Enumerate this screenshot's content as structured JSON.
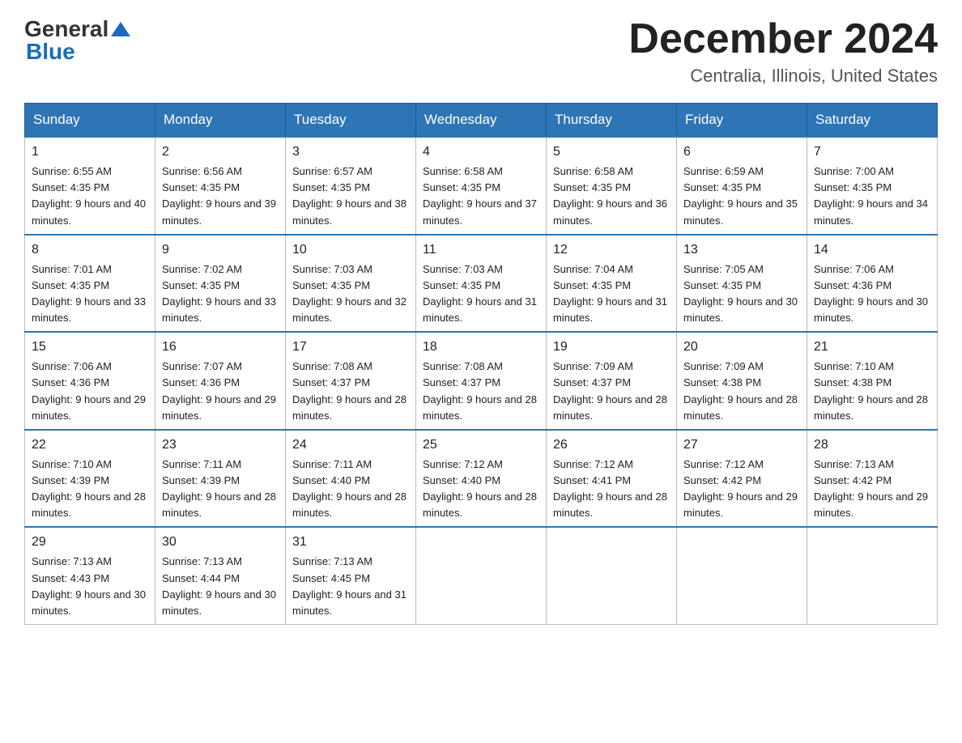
{
  "logo": {
    "general": "General",
    "blue": "Blue"
  },
  "header": {
    "month_year": "December 2024",
    "location": "Centralia, Illinois, United States"
  },
  "days_of_week": [
    "Sunday",
    "Monday",
    "Tuesday",
    "Wednesday",
    "Thursday",
    "Friday",
    "Saturday"
  ],
  "weeks": [
    [
      {
        "day": "1",
        "sunrise": "6:55 AM",
        "sunset": "4:35 PM",
        "daylight": "9 hours and 40 minutes."
      },
      {
        "day": "2",
        "sunrise": "6:56 AM",
        "sunset": "4:35 PM",
        "daylight": "9 hours and 39 minutes."
      },
      {
        "day": "3",
        "sunrise": "6:57 AM",
        "sunset": "4:35 PM",
        "daylight": "9 hours and 38 minutes."
      },
      {
        "day": "4",
        "sunrise": "6:58 AM",
        "sunset": "4:35 PM",
        "daylight": "9 hours and 37 minutes."
      },
      {
        "day": "5",
        "sunrise": "6:58 AM",
        "sunset": "4:35 PM",
        "daylight": "9 hours and 36 minutes."
      },
      {
        "day": "6",
        "sunrise": "6:59 AM",
        "sunset": "4:35 PM",
        "daylight": "9 hours and 35 minutes."
      },
      {
        "day": "7",
        "sunrise": "7:00 AM",
        "sunset": "4:35 PM",
        "daylight": "9 hours and 34 minutes."
      }
    ],
    [
      {
        "day": "8",
        "sunrise": "7:01 AM",
        "sunset": "4:35 PM",
        "daylight": "9 hours and 33 minutes."
      },
      {
        "day": "9",
        "sunrise": "7:02 AM",
        "sunset": "4:35 PM",
        "daylight": "9 hours and 33 minutes."
      },
      {
        "day": "10",
        "sunrise": "7:03 AM",
        "sunset": "4:35 PM",
        "daylight": "9 hours and 32 minutes."
      },
      {
        "day": "11",
        "sunrise": "7:03 AM",
        "sunset": "4:35 PM",
        "daylight": "9 hours and 31 minutes."
      },
      {
        "day": "12",
        "sunrise": "7:04 AM",
        "sunset": "4:35 PM",
        "daylight": "9 hours and 31 minutes."
      },
      {
        "day": "13",
        "sunrise": "7:05 AM",
        "sunset": "4:35 PM",
        "daylight": "9 hours and 30 minutes."
      },
      {
        "day": "14",
        "sunrise": "7:06 AM",
        "sunset": "4:36 PM",
        "daylight": "9 hours and 30 minutes."
      }
    ],
    [
      {
        "day": "15",
        "sunrise": "7:06 AM",
        "sunset": "4:36 PM",
        "daylight": "9 hours and 29 minutes."
      },
      {
        "day": "16",
        "sunrise": "7:07 AM",
        "sunset": "4:36 PM",
        "daylight": "9 hours and 29 minutes."
      },
      {
        "day": "17",
        "sunrise": "7:08 AM",
        "sunset": "4:37 PM",
        "daylight": "9 hours and 28 minutes."
      },
      {
        "day": "18",
        "sunrise": "7:08 AM",
        "sunset": "4:37 PM",
        "daylight": "9 hours and 28 minutes."
      },
      {
        "day": "19",
        "sunrise": "7:09 AM",
        "sunset": "4:37 PM",
        "daylight": "9 hours and 28 minutes."
      },
      {
        "day": "20",
        "sunrise": "7:09 AM",
        "sunset": "4:38 PM",
        "daylight": "9 hours and 28 minutes."
      },
      {
        "day": "21",
        "sunrise": "7:10 AM",
        "sunset": "4:38 PM",
        "daylight": "9 hours and 28 minutes."
      }
    ],
    [
      {
        "day": "22",
        "sunrise": "7:10 AM",
        "sunset": "4:39 PM",
        "daylight": "9 hours and 28 minutes."
      },
      {
        "day": "23",
        "sunrise": "7:11 AM",
        "sunset": "4:39 PM",
        "daylight": "9 hours and 28 minutes."
      },
      {
        "day": "24",
        "sunrise": "7:11 AM",
        "sunset": "4:40 PM",
        "daylight": "9 hours and 28 minutes."
      },
      {
        "day": "25",
        "sunrise": "7:12 AM",
        "sunset": "4:40 PM",
        "daylight": "9 hours and 28 minutes."
      },
      {
        "day": "26",
        "sunrise": "7:12 AM",
        "sunset": "4:41 PM",
        "daylight": "9 hours and 28 minutes."
      },
      {
        "day": "27",
        "sunrise": "7:12 AM",
        "sunset": "4:42 PM",
        "daylight": "9 hours and 29 minutes."
      },
      {
        "day": "28",
        "sunrise": "7:13 AM",
        "sunset": "4:42 PM",
        "daylight": "9 hours and 29 minutes."
      }
    ],
    [
      {
        "day": "29",
        "sunrise": "7:13 AM",
        "sunset": "4:43 PM",
        "daylight": "9 hours and 30 minutes."
      },
      {
        "day": "30",
        "sunrise": "7:13 AM",
        "sunset": "4:44 PM",
        "daylight": "9 hours and 30 minutes."
      },
      {
        "day": "31",
        "sunrise": "7:13 AM",
        "sunset": "4:45 PM",
        "daylight": "9 hours and 31 minutes."
      },
      null,
      null,
      null,
      null
    ]
  ],
  "labels": {
    "sunrise": "Sunrise: ",
    "sunset": "Sunset: ",
    "daylight": "Daylight: "
  }
}
